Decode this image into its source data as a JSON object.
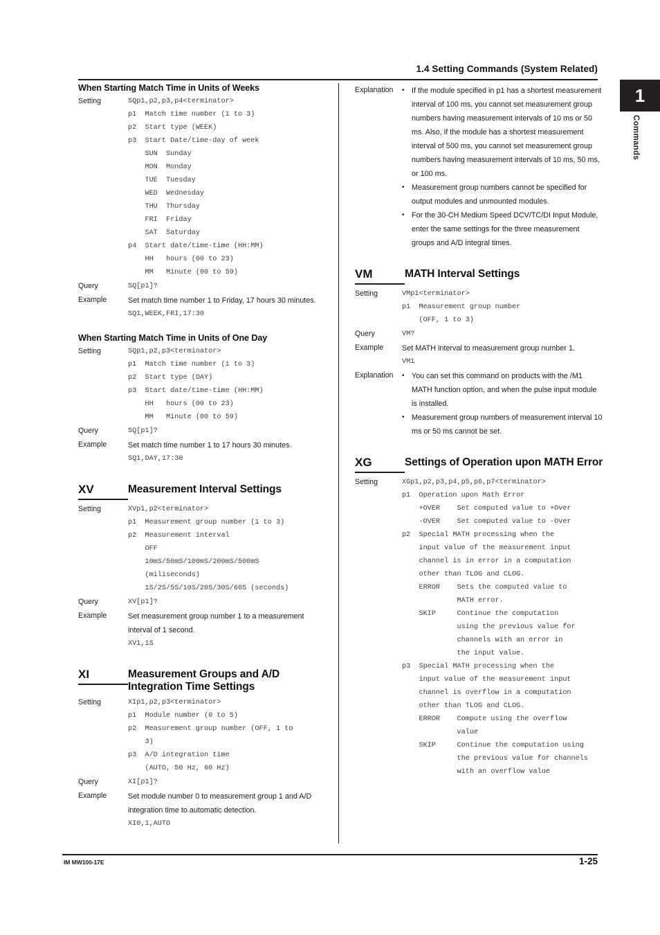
{
  "header": {
    "section_title": "1.4  Setting Commands (System Related)"
  },
  "side_tab": {
    "number": "1",
    "label": "Commands"
  },
  "footer": {
    "manual_code": "IM MW100-17E",
    "page_number": "1-25"
  },
  "left_column": {
    "section_weeks": {
      "heading": "When Starting Match Time in Units of Weeks",
      "setting_label": "Setting",
      "setting_lines": [
        "SQp1,p2,p3,p4<terminator>",
        "p1  Match time number (1 to 3)",
        "p2  Start type (WEEK)",
        "p3  Start Date/time-day of week",
        "    SUN  Sunday",
        "    MON  Monday",
        "    TUE  Tuesday",
        "    WED  Wednesday",
        "    THU  Thursday",
        "    FRI  Friday",
        "    SAT  Saturday",
        "p4  Start date/time-time (HH:MM)",
        "    HH   hours (00 to 23)",
        "    MM   Minute (00 to 59)"
      ],
      "query_label": "Query",
      "query_text": "SQ[p1]?",
      "example_label": "Example",
      "example_text": "Set match time number 1 to Friday, 17 hours 30 minutes.",
      "example_code": "SQ1,WEEK,FRI,17:30"
    },
    "section_one_day": {
      "heading": "When Starting Match Time in Units of One Day",
      "setting_label": "Setting",
      "setting_lines": [
        "SQp1,p2,p3<terminator>",
        "p1  Match time number (1 to 3)",
        "p2  Start type (DAY)",
        "p3  Start date/time-time (HH:MM)",
        "    HH   hours (00 to 23)",
        "    MM   Minute (00 to 59)"
      ],
      "query_label": "Query",
      "query_text": "SQ[p1]?",
      "example_label": "Example",
      "example_text": "Set match time number 1 to 17 hours 30 minutes.",
      "example_code": "SQ1,DAY,17:30"
    },
    "command_xv": {
      "letter": "XV",
      "title": "Measurement Interval Settings",
      "setting_label": "Setting",
      "setting_lines": [
        "XVp1,p2<terminator>",
        "p1  Measurement group number (1 to 3)",
        "p2  Measurement interval",
        "    OFF",
        "    10mS/50mS/100mS/200mS/500mS",
        "    (miliseconds)",
        "    1S/2S/5S/10S/20S/30S/60S (seconds)"
      ],
      "query_label": "Query",
      "query_text": "XV[p1]?",
      "example_label": "Example",
      "example_text": "Set measurement group number 1 to a measurement interval of 1 second.",
      "example_code": "XV1,1S"
    },
    "command_xi": {
      "letter": "XI",
      "title": "Measurement Groups and A/D Integration Time Settings",
      "setting_label": "Setting",
      "setting_lines": [
        "XIp1,p2,p3<terminator>",
        "p1  Module number (0 to 5)",
        "p2  Measurement group number (OFF, 1 to",
        "    3)",
        "p3  A/D integration time",
        "    (AUTO, 50 Hz, 60 Hz)"
      ],
      "query_label": "Query",
      "query_text": "XI[p1]?",
      "example_label": "Example",
      "example_text": "Set module number 0 to measurement group 1 and A/D integration time to automatic detection.",
      "example_code": "XI0,1,AUTO"
    }
  },
  "right_column": {
    "explanation_top": {
      "label": "Explanation",
      "bullets": [
        "If the module specified in p1 has a shortest measurement interval of 100 ms, you cannot set measurement group numbers having measurement intervals of 10 ms or 50 ms. Also, if the module has a shortest measurement interval of 500 ms, you cannot set measurement group numbers having measurement intervals of 10 ms, 50 ms, or 100 ms.",
        "Measurement group numbers cannot be specified for output modules and unmounted modules.",
        "For the 30-CH Medium Speed DCV/TC/DI Input Module, enter the same settings for the three measurement groups and A/D integral times."
      ]
    },
    "command_vm": {
      "letter": "VM",
      "title": "MATH Interval Settings",
      "setting_label": "Setting",
      "setting_lines": [
        "VMp1<terminator>",
        "p1  Measurement group number",
        "    (OFF, 1 to 3)"
      ],
      "query_label": "Query",
      "query_text": "VM?",
      "example_label": "Example",
      "example_text": "Set MATH interval to measurement group number 1.",
      "example_code": "VM1",
      "explanation_label": "Explanation",
      "explanation_bullets": [
        "You can set this command on products with the /M1 MATH function option, and when the pulse input module is installed.",
        "Measurement group numbers of measurement interval 10 ms or 50 ms cannot be set."
      ]
    },
    "command_xg": {
      "letter": "XG",
      "title": "Settings of Operation upon MATH Error",
      "setting_label": "Setting",
      "setting_lines": [
        "XGp1,p2,p3,p4,p5,p6,p7<terminator>",
        "p1  Operation upon Math Error",
        "    +OVER    Set computed value to +Over",
        "    -OVER    Set computed value to -Over",
        "p2  Special MATH processing when the",
        "    input value of the measurement input",
        "    channel is in error in a computation",
        "    other than TLOG and CLOG.",
        "    ERROR    Sets the computed value to",
        "             MATH error.",
        "    SKIP     Continue the computation",
        "             using the previous value for",
        "             channels with an error in",
        "             the input value.",
        "p3  Special MATH processing when the",
        "    input value of the measurement input",
        "    channel is overflow in a computation",
        "    other than TLOG and CLOG.",
        "    ERROR    Compute using the overflow",
        "             value",
        "    SKIP     Continue the computation using",
        "             the previous value for channels",
        "             with an overflow value"
      ]
    }
  }
}
